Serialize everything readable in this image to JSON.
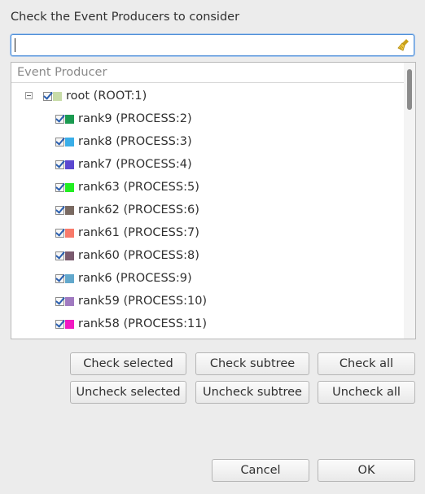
{
  "dialog": {
    "prompt": "Check the Event Producers to consider",
    "filter_value": ""
  },
  "tree": {
    "column_header": "Event Producer",
    "root": {
      "label": "root (ROOT:1)",
      "checked": true,
      "expanded": true,
      "color": "#c8dca8"
    },
    "items": [
      {
        "label": "rank9 (PROCESS:2)",
        "checked": true,
        "color": "#1a9a50"
      },
      {
        "label": "rank8 (PROCESS:3)",
        "checked": true,
        "color": "#3aaee8"
      },
      {
        "label": "rank7 (PROCESS:4)",
        "checked": true,
        "color": "#5c48d0"
      },
      {
        "label": "rank63 (PROCESS:5)",
        "checked": true,
        "color": "#22ee22"
      },
      {
        "label": "rank62 (PROCESS:6)",
        "checked": true,
        "color": "#7a6a62"
      },
      {
        "label": "rank61 (PROCESS:7)",
        "checked": true,
        "color": "#f87a6a"
      },
      {
        "label": "rank60 (PROCESS:8)",
        "checked": true,
        "color": "#7a5a6e"
      },
      {
        "label": "rank6 (PROCESS:9)",
        "checked": true,
        "color": "#62a8cc"
      },
      {
        "label": "rank59 (PROCESS:10)",
        "checked": true,
        "color": "#a07ac0"
      },
      {
        "label": "rank58 (PROCESS:11)",
        "checked": true,
        "color": "#f21ac2"
      }
    ]
  },
  "buttons": {
    "check_selected": "Check selected",
    "check_subtree": "Check subtree",
    "check_all": "Check all",
    "uncheck_selected": "Uncheck selected",
    "uncheck_subtree": "Uncheck subtree",
    "uncheck_all": "Uncheck all",
    "cancel": "Cancel",
    "ok": "OK"
  }
}
